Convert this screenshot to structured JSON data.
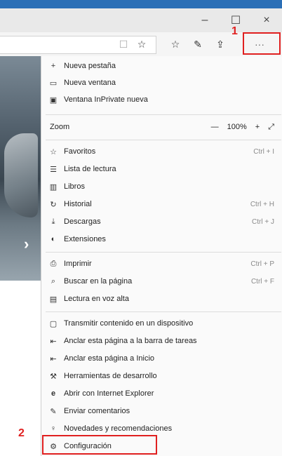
{
  "window": {
    "minimize": "–",
    "maximize": "☐",
    "close": "×"
  },
  "toolbar": {
    "reading_view": "☐",
    "favorite": "☆",
    "favorites_hub": "☆",
    "notes": "✎",
    "share": "⇪",
    "more": "···"
  },
  "menu": {
    "group1": [
      {
        "icon": "+",
        "label": "Nueva pestaña"
      },
      {
        "icon": "▭",
        "label": "Nueva ventana"
      },
      {
        "icon": "▣",
        "label": "Ventana InPrivate nueva"
      }
    ],
    "zoom": {
      "label": "Zoom",
      "minus": "—",
      "value": "100%",
      "plus": "+",
      "fullscreen": "⤢"
    },
    "group2": [
      {
        "icon": "☆",
        "label": "Favoritos",
        "shortcut": "Ctrl + I"
      },
      {
        "icon": "☰",
        "label": "Lista de lectura",
        "shortcut": ""
      },
      {
        "icon": "▥",
        "label": "Libros",
        "shortcut": ""
      },
      {
        "icon": "↻",
        "label": "Historial",
        "shortcut": "Ctrl + H"
      },
      {
        "icon": "⤓",
        "label": "Descargas",
        "shortcut": "Ctrl + J"
      },
      {
        "icon": "◐",
        "label": "Extensiones",
        "shortcut": ""
      }
    ],
    "group3": [
      {
        "icon": "⎙",
        "label": "Imprimir",
        "shortcut": "Ctrl + P"
      },
      {
        "icon": "⌕",
        "label": "Buscar en la página",
        "shortcut": "Ctrl + F"
      },
      {
        "icon": "▤",
        "label": "Lectura en voz alta",
        "shortcut": ""
      }
    ],
    "group4": [
      {
        "icon": "▢",
        "label": "Transmitir contenido en un dispositivo"
      },
      {
        "icon": "⇤",
        "label": "Anclar esta página a la barra de tareas"
      },
      {
        "icon": "⇤",
        "label": "Anclar esta página a Inicio"
      },
      {
        "icon": "⚒",
        "label": "Herramientas de desarrollo"
      },
      {
        "icon": "e",
        "label": "Abrir con Internet Explorer"
      },
      {
        "icon": "✎",
        "label": "Enviar comentarios"
      },
      {
        "icon": "♀",
        "label": "Novedades y recomendaciones"
      },
      {
        "icon": "⚙",
        "label": "Configuración"
      }
    ]
  },
  "background": {
    "arrow": "›"
  },
  "annotations": {
    "step1": "1",
    "step2": "2",
    "highlight_color": "#e02020"
  }
}
